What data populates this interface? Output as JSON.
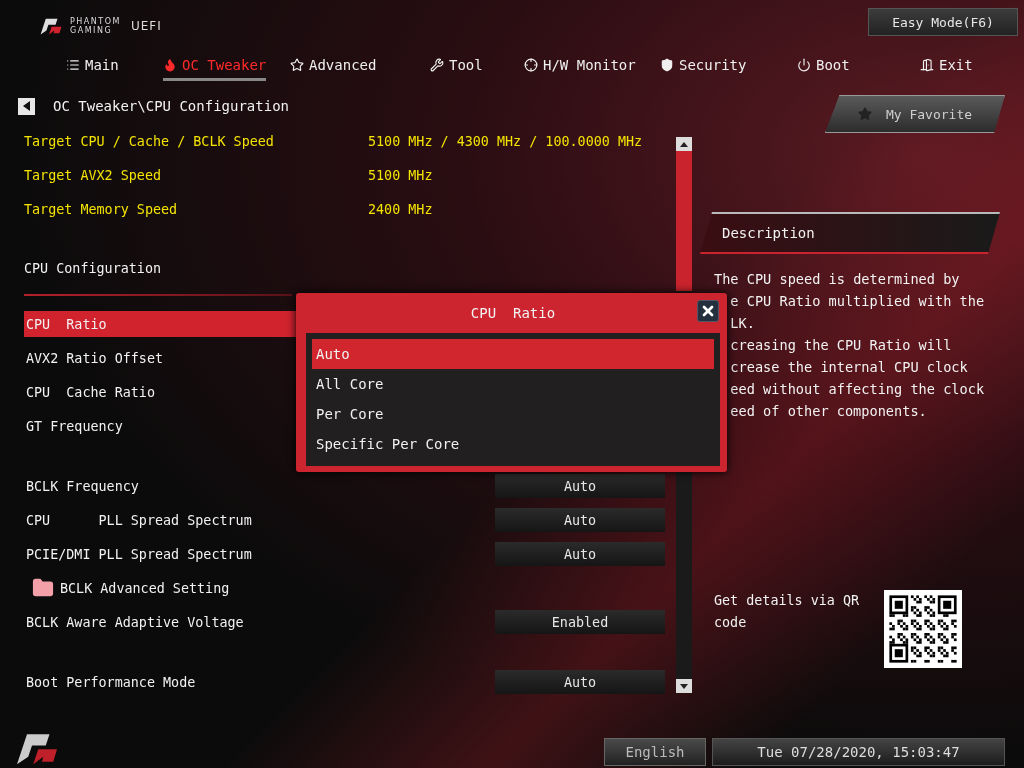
{
  "logo": {
    "line1": "PHANTOM",
    "line2": "GAMING",
    "suffix": "UEFI"
  },
  "mode_button": "Easy Mode(F6)",
  "tabs": [
    {
      "label": "Main",
      "selected": false
    },
    {
      "label": "OC Tweaker",
      "selected": true
    },
    {
      "label": "Advanced",
      "selected": false
    },
    {
      "label": "Tool",
      "selected": false
    },
    {
      "label": "H/W Monitor",
      "selected": false
    },
    {
      "label": "Security",
      "selected": false
    },
    {
      "label": "Boot",
      "selected": false
    },
    {
      "label": "Exit",
      "selected": false
    }
  ],
  "breadcrumb": "OC Tweaker\\CPU Configuration",
  "favorite_button": "My Favorite",
  "info_rows": [
    {
      "label": "Target CPU / Cache / BCLK Speed",
      "value": "5100 MHz / 4300 MHz / 100.0000 MHz"
    },
    {
      "label": "Target AVX2 Speed",
      "value": "5100 MHz"
    },
    {
      "label": "Target Memory Speed",
      "value": "2400 MHz"
    }
  ],
  "section_title": "CPU Configuration",
  "setting_groups": [
    [
      {
        "kind": "setting",
        "label": "CPU  Ratio",
        "selected": true
      },
      {
        "kind": "setting",
        "label": "AVX2 Ratio Offset",
        "selected": false
      },
      {
        "kind": "setting",
        "label": "CPU  Cache Ratio",
        "selected": false
      },
      {
        "kind": "setting",
        "label": "GT Frequency",
        "selected": false
      }
    ],
    [
      {
        "kind": "setting",
        "label": "BCLK Frequency",
        "value": "Auto",
        "selected": false
      },
      {
        "kind": "setting",
        "label": "CPU      PLL Spread Spectrum",
        "value": "Auto",
        "selected": false
      },
      {
        "kind": "setting",
        "label": "PCIE/DMI PLL Spread Spectrum",
        "value": "Auto",
        "selected": false
      },
      {
        "kind": "folder",
        "label": "BCLK Advanced Setting",
        "selected": false
      },
      {
        "kind": "setting",
        "label": "BCLK Aware Adaptive Voltage",
        "value": "Enabled",
        "selected": false
      }
    ],
    [
      {
        "kind": "setting",
        "label": "Boot Performance Mode",
        "value": "Auto",
        "selected": false
      }
    ]
  ],
  "modal": {
    "title": "CPU  Ratio",
    "options": [
      {
        "label": "Auto",
        "selected": true
      },
      {
        "label": "All Core",
        "selected": false
      },
      {
        "label": "Per Core",
        "selected": false
      },
      {
        "label": "Specific Per Core",
        "selected": false
      }
    ]
  },
  "description": {
    "title": "Description",
    "lines": [
      "The CPU speed is determined by",
      "e CPU Ratio multiplied with the",
      "LK.",
      "creasing the CPU Ratio will",
      "crease the internal CPU clock",
      "eed without affecting the clock",
      "eed of other components."
    ]
  },
  "qr": {
    "text": "Get details via QR code"
  },
  "footer": {
    "language": "English",
    "datetime": "Tue 07/28/2020, 15:03:47"
  }
}
